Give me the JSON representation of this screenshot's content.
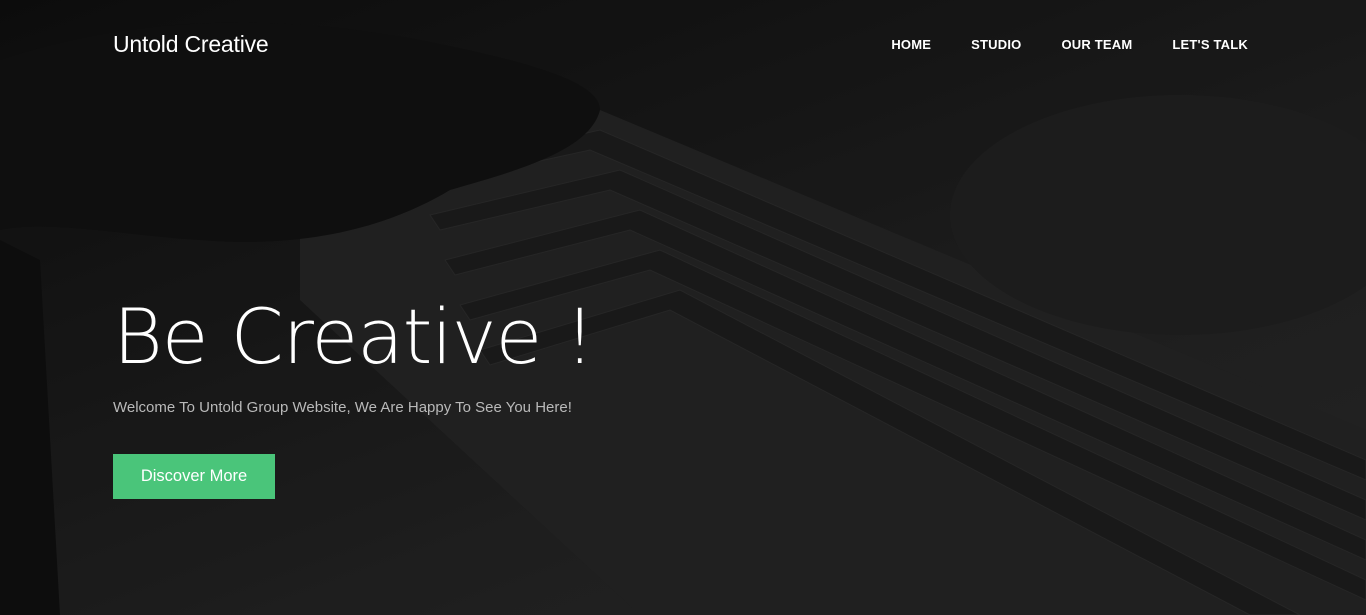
{
  "header": {
    "brand": "Untold Creative",
    "nav": [
      {
        "label": "HOME"
      },
      {
        "label": "STUDIO"
      },
      {
        "label": "OUR TEAM"
      },
      {
        "label": "LET'S TALK"
      }
    ]
  },
  "hero": {
    "title": "Be Creative !",
    "subtitle": "Welcome To Untold Group Website, We Are Happy To See You Here!",
    "cta_label": "Discover More"
  },
  "colors": {
    "accent": "#4ac57a",
    "background": "#1e1e1e"
  }
}
